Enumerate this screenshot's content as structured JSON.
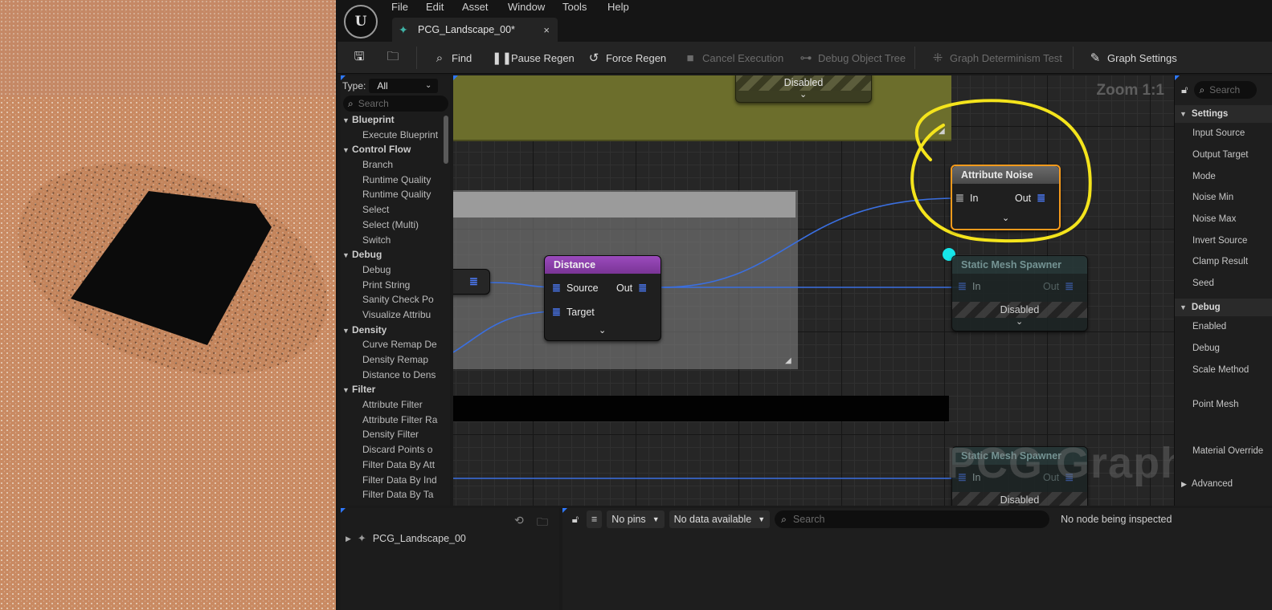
{
  "app": {
    "menu": [
      "File",
      "Edit",
      "Asset",
      "Window",
      "Tools",
      "Help"
    ],
    "tab_label": "PCG_Landscape_00*",
    "tab_close": "×",
    "logo": "U"
  },
  "toolbar": {
    "find": "Find",
    "pause_regen": "Pause Regen",
    "force_regen": "Force Regen",
    "cancel_execution": "Cancel Execution",
    "debug_object_tree": "Debug Object Tree",
    "graph_determinism_test": "Graph Determinism Test",
    "graph_settings": "Graph Settings"
  },
  "palette": {
    "type_label": "Type:",
    "type_value": "All",
    "search_placeholder": "Search",
    "categories": [
      {
        "name": "Blueprint",
        "items": [
          "Execute Blueprint"
        ]
      },
      {
        "name": "Control Flow",
        "items": [
          "Branch",
          "Runtime Quality",
          "Runtime Quality",
          "Select",
          "Select (Multi)",
          "Switch"
        ]
      },
      {
        "name": "Debug",
        "items": [
          "Debug",
          "Print String",
          "Sanity Check Po",
          "Visualize Attribu"
        ]
      },
      {
        "name": "Density",
        "items": [
          "Curve Remap De",
          "Density Remap",
          "Distance to Dens"
        ]
      },
      {
        "name": "Filter",
        "items": [
          "Attribute Filter",
          "Attribute Filter Ra",
          "Density Filter",
          "Discard Points o",
          "Filter Data By Att",
          "Filter Data By Ind",
          "Filter Data By Ta"
        ]
      }
    ]
  },
  "graph": {
    "zoom": "Zoom 1:1",
    "watermark": "PCG Graph",
    "top_node_disabled": "Disabled",
    "distance_node": {
      "title": "Distance",
      "source": "Source",
      "target": "Target",
      "out": "Out"
    },
    "attribute_noise_node": {
      "title": "Attribute Noise",
      "in": "In",
      "out": "Out"
    },
    "static_mesh_spawner_1": {
      "title": "Static Mesh Spawner",
      "in": "In",
      "out": "Out",
      "status": "Disabled"
    },
    "static_mesh_spawner_2": {
      "title": "Static Mesh Spawner",
      "in": "In",
      "out": "Out",
      "status": "Disabled"
    }
  },
  "details": {
    "search_placeholder": "Search",
    "settings_category": "Settings",
    "settings_rows": [
      "Input Source",
      "Output Target",
      "Mode",
      "Noise Min",
      "Noise Max",
      "Invert Source",
      "Clamp Result",
      "Seed"
    ],
    "debug_category": "Debug",
    "debug_rows": [
      "Enabled",
      "Debug",
      "Scale Method",
      "Point Mesh",
      "Material Override"
    ],
    "advanced": "Advanced"
  },
  "outliner": {
    "item": "PCG_Landscape_00"
  },
  "inspector": {
    "pins": "No pins",
    "data": "No data available",
    "search_placeholder": "Search",
    "status": "No node being inspected"
  },
  "colors": {
    "accent_blue": "#2e78ff",
    "annotation_yellow": "#f4e41c",
    "selection_orange": "#f59a1c",
    "distance_header": "#8a3fa8",
    "comment_olive": "#6c6e2c"
  }
}
